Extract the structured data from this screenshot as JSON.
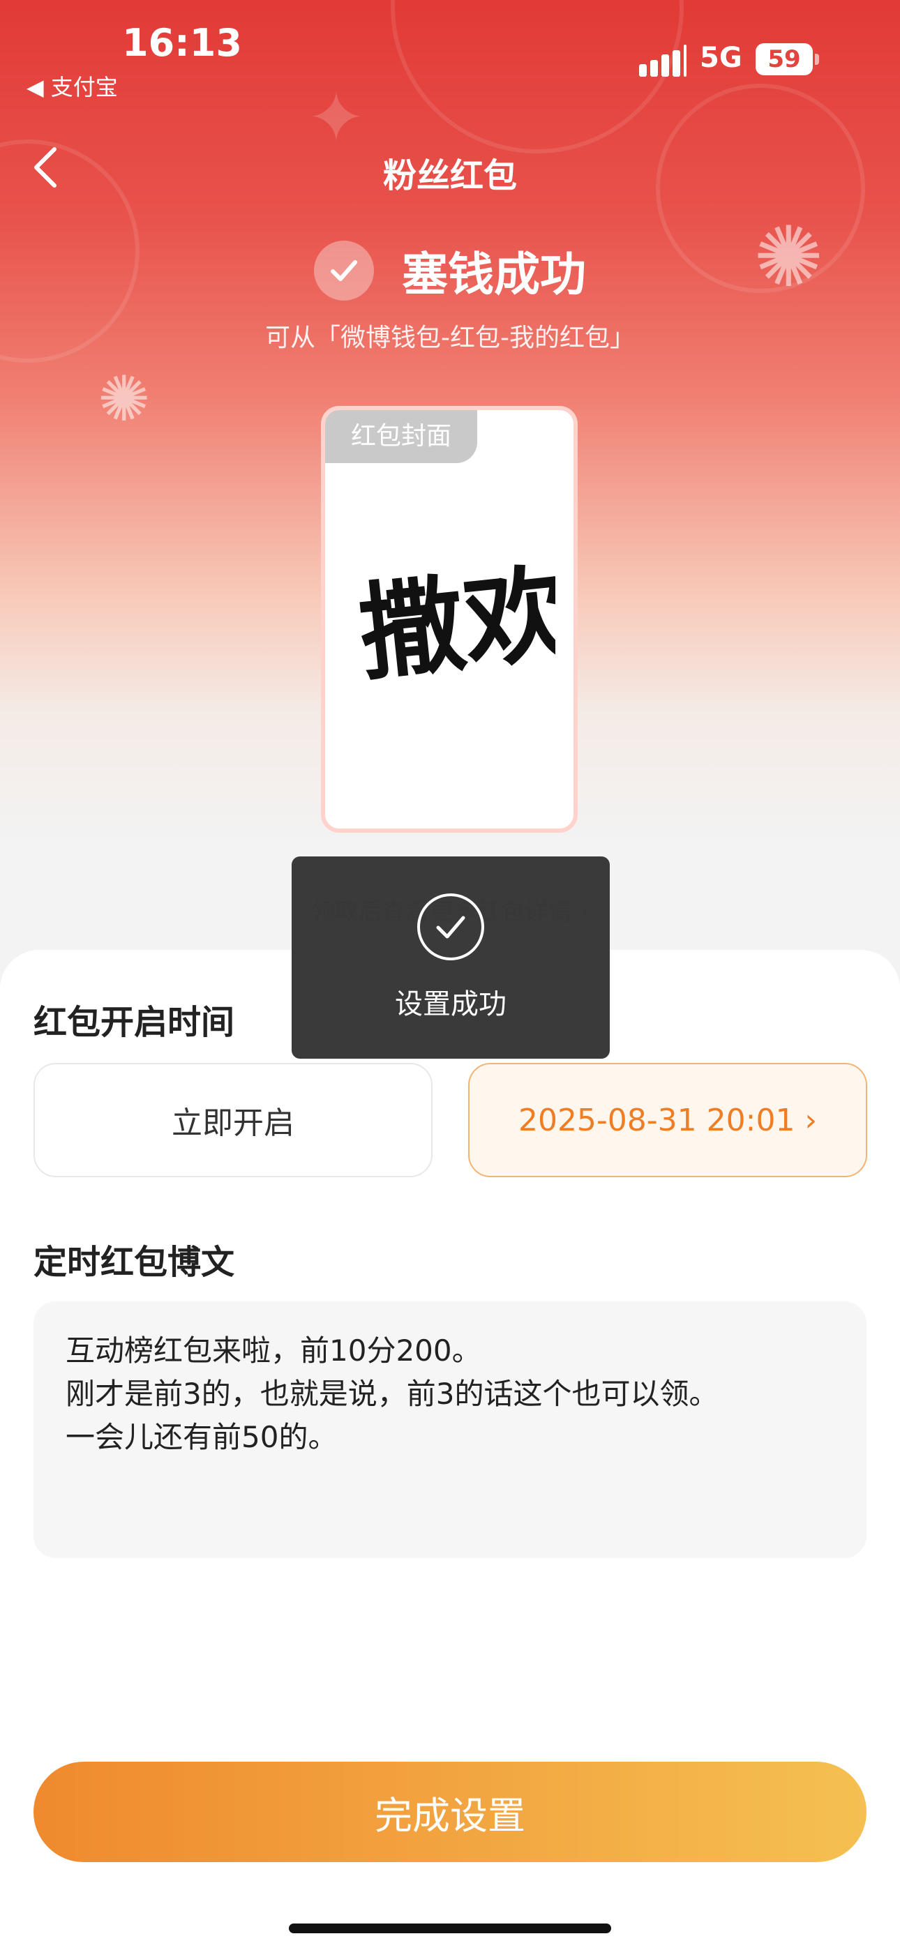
{
  "status_bar": {
    "time": "16:13",
    "back_app_label": "◀ 支付宝",
    "network": "5G",
    "battery": "59"
  },
  "nav": {
    "title": "粉丝红包"
  },
  "success": {
    "title": "塞钱成功",
    "hint": "可从「微博钱包-红包-我的红包」"
  },
  "cover": {
    "tag": "红包封面",
    "calligraphy_text": "撒欢"
  },
  "hidden_link": "领取后查看更多红包详情 ›",
  "open_time": {
    "section_title": "红包开启时间",
    "option_now": "立即开启",
    "option_scheduled": "2025-08-31 20:01 ›"
  },
  "post": {
    "section_title": "定时红包博文",
    "lines": [
      "互动榜红包来啦，前10分200。",
      "刚才是前3的，也就是说，前3的话这个也可以领。",
      "一会儿还有前50的。"
    ]
  },
  "finish_button": "完成设置",
  "toast": {
    "text": "设置成功"
  },
  "colors": {
    "brand_red": "#e23a36",
    "accent_orange": "#ee7d24",
    "toast_bg": "#323232"
  }
}
